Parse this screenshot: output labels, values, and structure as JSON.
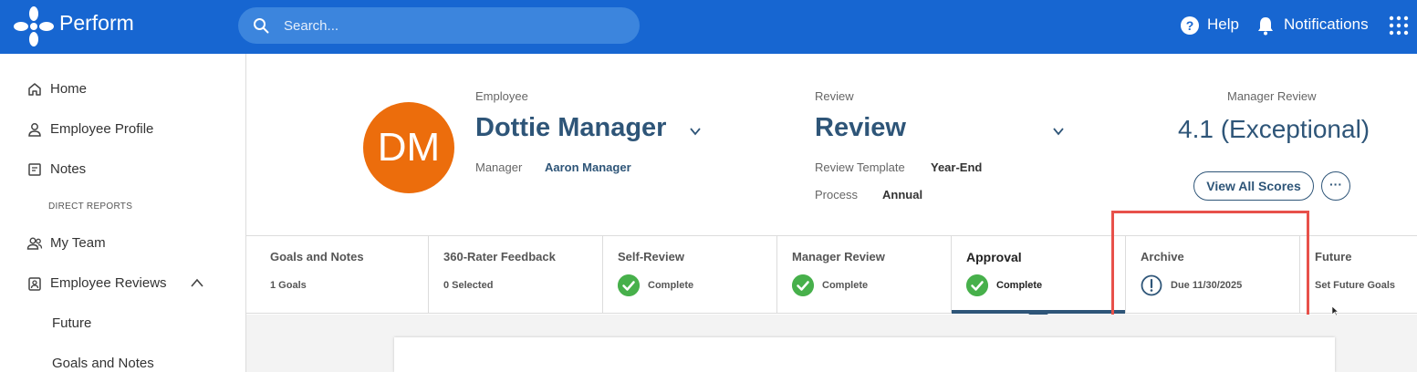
{
  "topbar": {
    "brand": "Perform",
    "search_placeholder": "Search...",
    "help_label": "Help",
    "notifications_label": "Notifications",
    "icons": [
      "logo-icon",
      "search-icon",
      "help-icon",
      "bell-icon",
      "apps-grid-icon"
    ],
    "color": "#1766d1"
  },
  "sidebar": {
    "items": [
      {
        "label": "Home",
        "icon": "home-icon"
      },
      {
        "label": "Employee Profile",
        "icon": "person-icon"
      },
      {
        "label": "Notes",
        "icon": "notes-icon"
      }
    ],
    "section_heading": "DIRECT REPORTS",
    "team_items": [
      {
        "label": "My Team",
        "icon": "team-icon"
      },
      {
        "label": "Employee Reviews",
        "icon": "review-badge-icon",
        "expanded": true
      }
    ],
    "sub_items": [
      {
        "label": "Future"
      },
      {
        "label": "Goals and Notes"
      }
    ]
  },
  "header": {
    "avatar_initials": "DM",
    "avatar_color": "#ec6d0c",
    "employee_label": "Employee",
    "employee_name": "Dottie Manager",
    "manager_label": "Manager",
    "manager_name": "Aaron Manager",
    "review_label": "Review",
    "review_name": "Review",
    "template_label": "Review Template",
    "template_value": "Year-End",
    "process_label": "Process",
    "process_value": "Annual",
    "manager_review_label": "Manager Review",
    "score": "4.1 (Exceptional)",
    "view_scores_label": "View All Scores",
    "more_label": "···"
  },
  "tabs": [
    {
      "title": "Goals and Notes",
      "status": "1 Goals",
      "state": "none"
    },
    {
      "title": "360-Rater Feedback",
      "status": "0 Selected",
      "state": "none"
    },
    {
      "title": "Self-Review",
      "status": "Complete",
      "state": "complete"
    },
    {
      "title": "Manager Review",
      "status": "Complete",
      "state": "complete"
    },
    {
      "title": "Approval",
      "status": "Complete",
      "state": "complete",
      "active": true
    },
    {
      "title": "Archive",
      "status": "Due 11/30/2025",
      "state": "due"
    },
    {
      "title": "Future",
      "status": "Set Future Goals",
      "state": "none"
    }
  ],
  "colors": {
    "accent": "#2e5578",
    "complete": "#47b04b",
    "highlight": "#e8514a"
  }
}
